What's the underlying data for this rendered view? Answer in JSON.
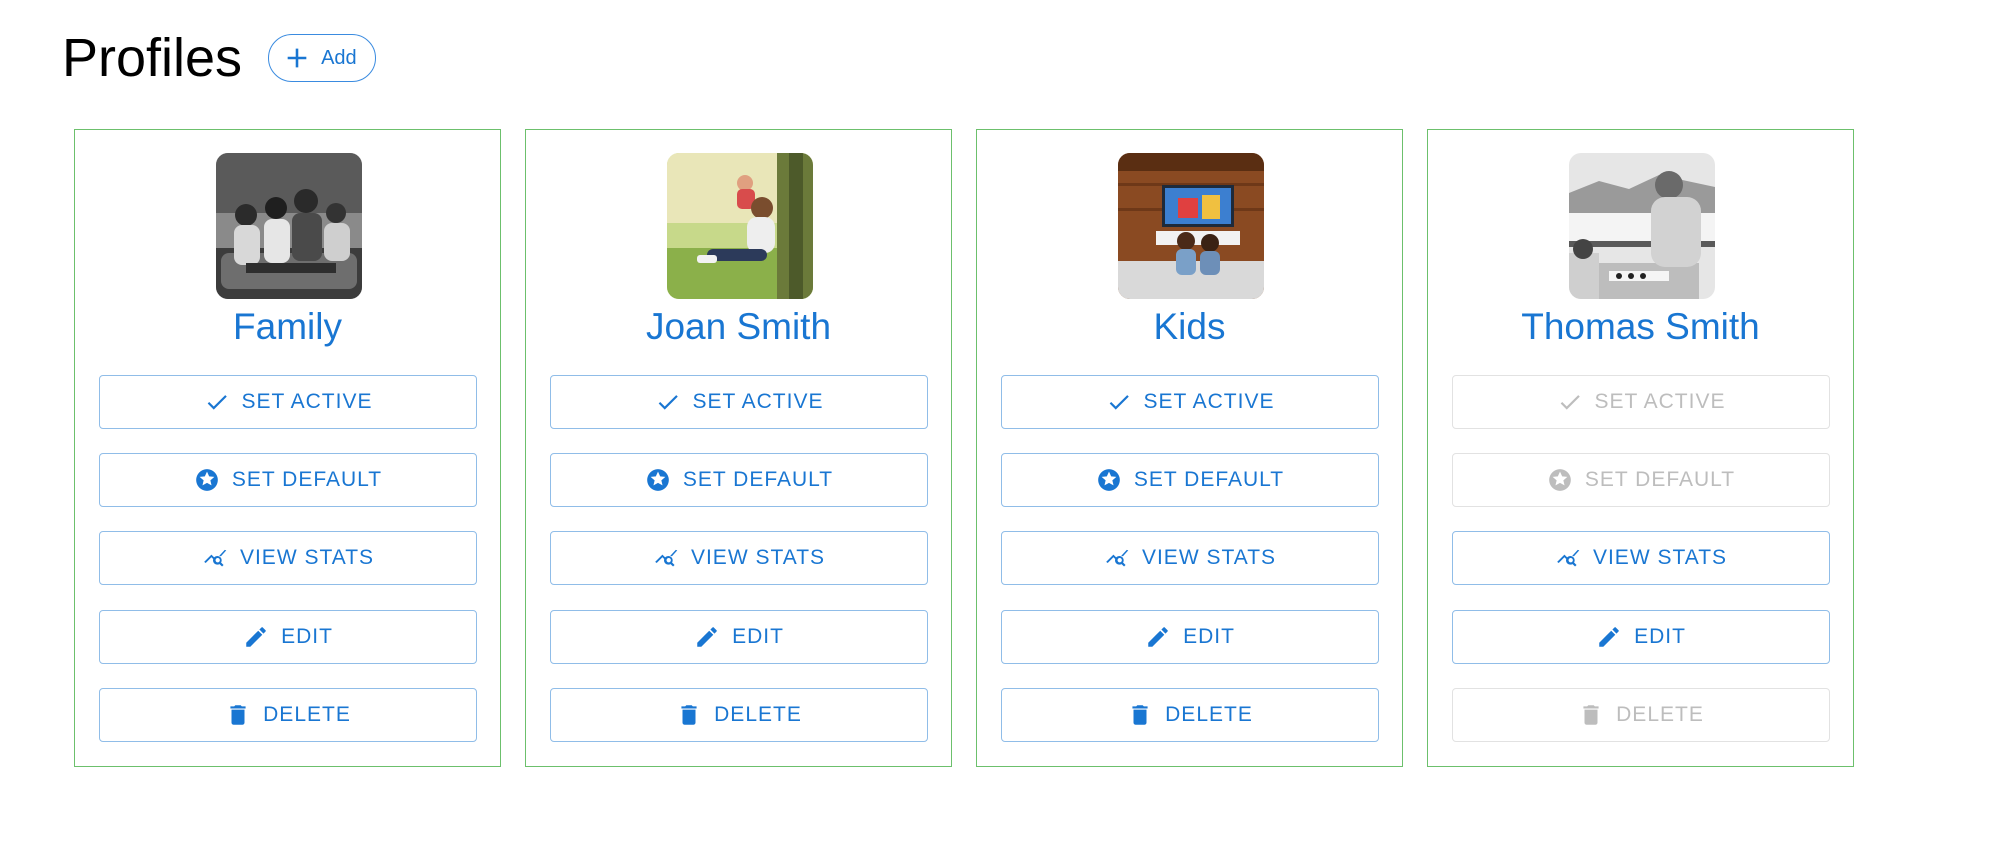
{
  "header": {
    "title": "Profiles",
    "add_label": "Add"
  },
  "colors": {
    "accent": "#1976d2",
    "card_border": "#6cc06c",
    "disabled": "#bdbdbd"
  },
  "profiles": [
    {
      "name": "Family",
      "photo": "family-photo",
      "buttons": {
        "set_active": "SET ACTIVE",
        "set_default": "SET DEFAULT",
        "view_stats": "VIEW STATS",
        "edit": "EDIT",
        "delete": "DELETE"
      }
    },
    {
      "name": "Joan Smith",
      "photo": "joan-smith-photo",
      "buttons": {
        "set_active": "SET ACTIVE",
        "set_default": "SET DEFAULT",
        "view_stats": "VIEW STATS",
        "edit": "EDIT",
        "delete": "DELETE"
      }
    },
    {
      "name": "Kids",
      "photo": "kids-photo",
      "buttons": {
        "set_active": "SET ACTIVE",
        "set_default": "SET DEFAULT",
        "view_stats": "VIEW STATS",
        "edit": "EDIT",
        "delete": "DELETE"
      }
    },
    {
      "name": "Thomas Smith",
      "photo": "thomas-smith-photo",
      "buttons": {
        "set_active": "SET ACTIVE",
        "set_default": "SET DEFAULT",
        "view_stats": "VIEW STATS",
        "edit": "EDIT",
        "delete": "DELETE"
      },
      "disabled_buttons": [
        "set_active",
        "set_default",
        "delete"
      ]
    }
  ]
}
